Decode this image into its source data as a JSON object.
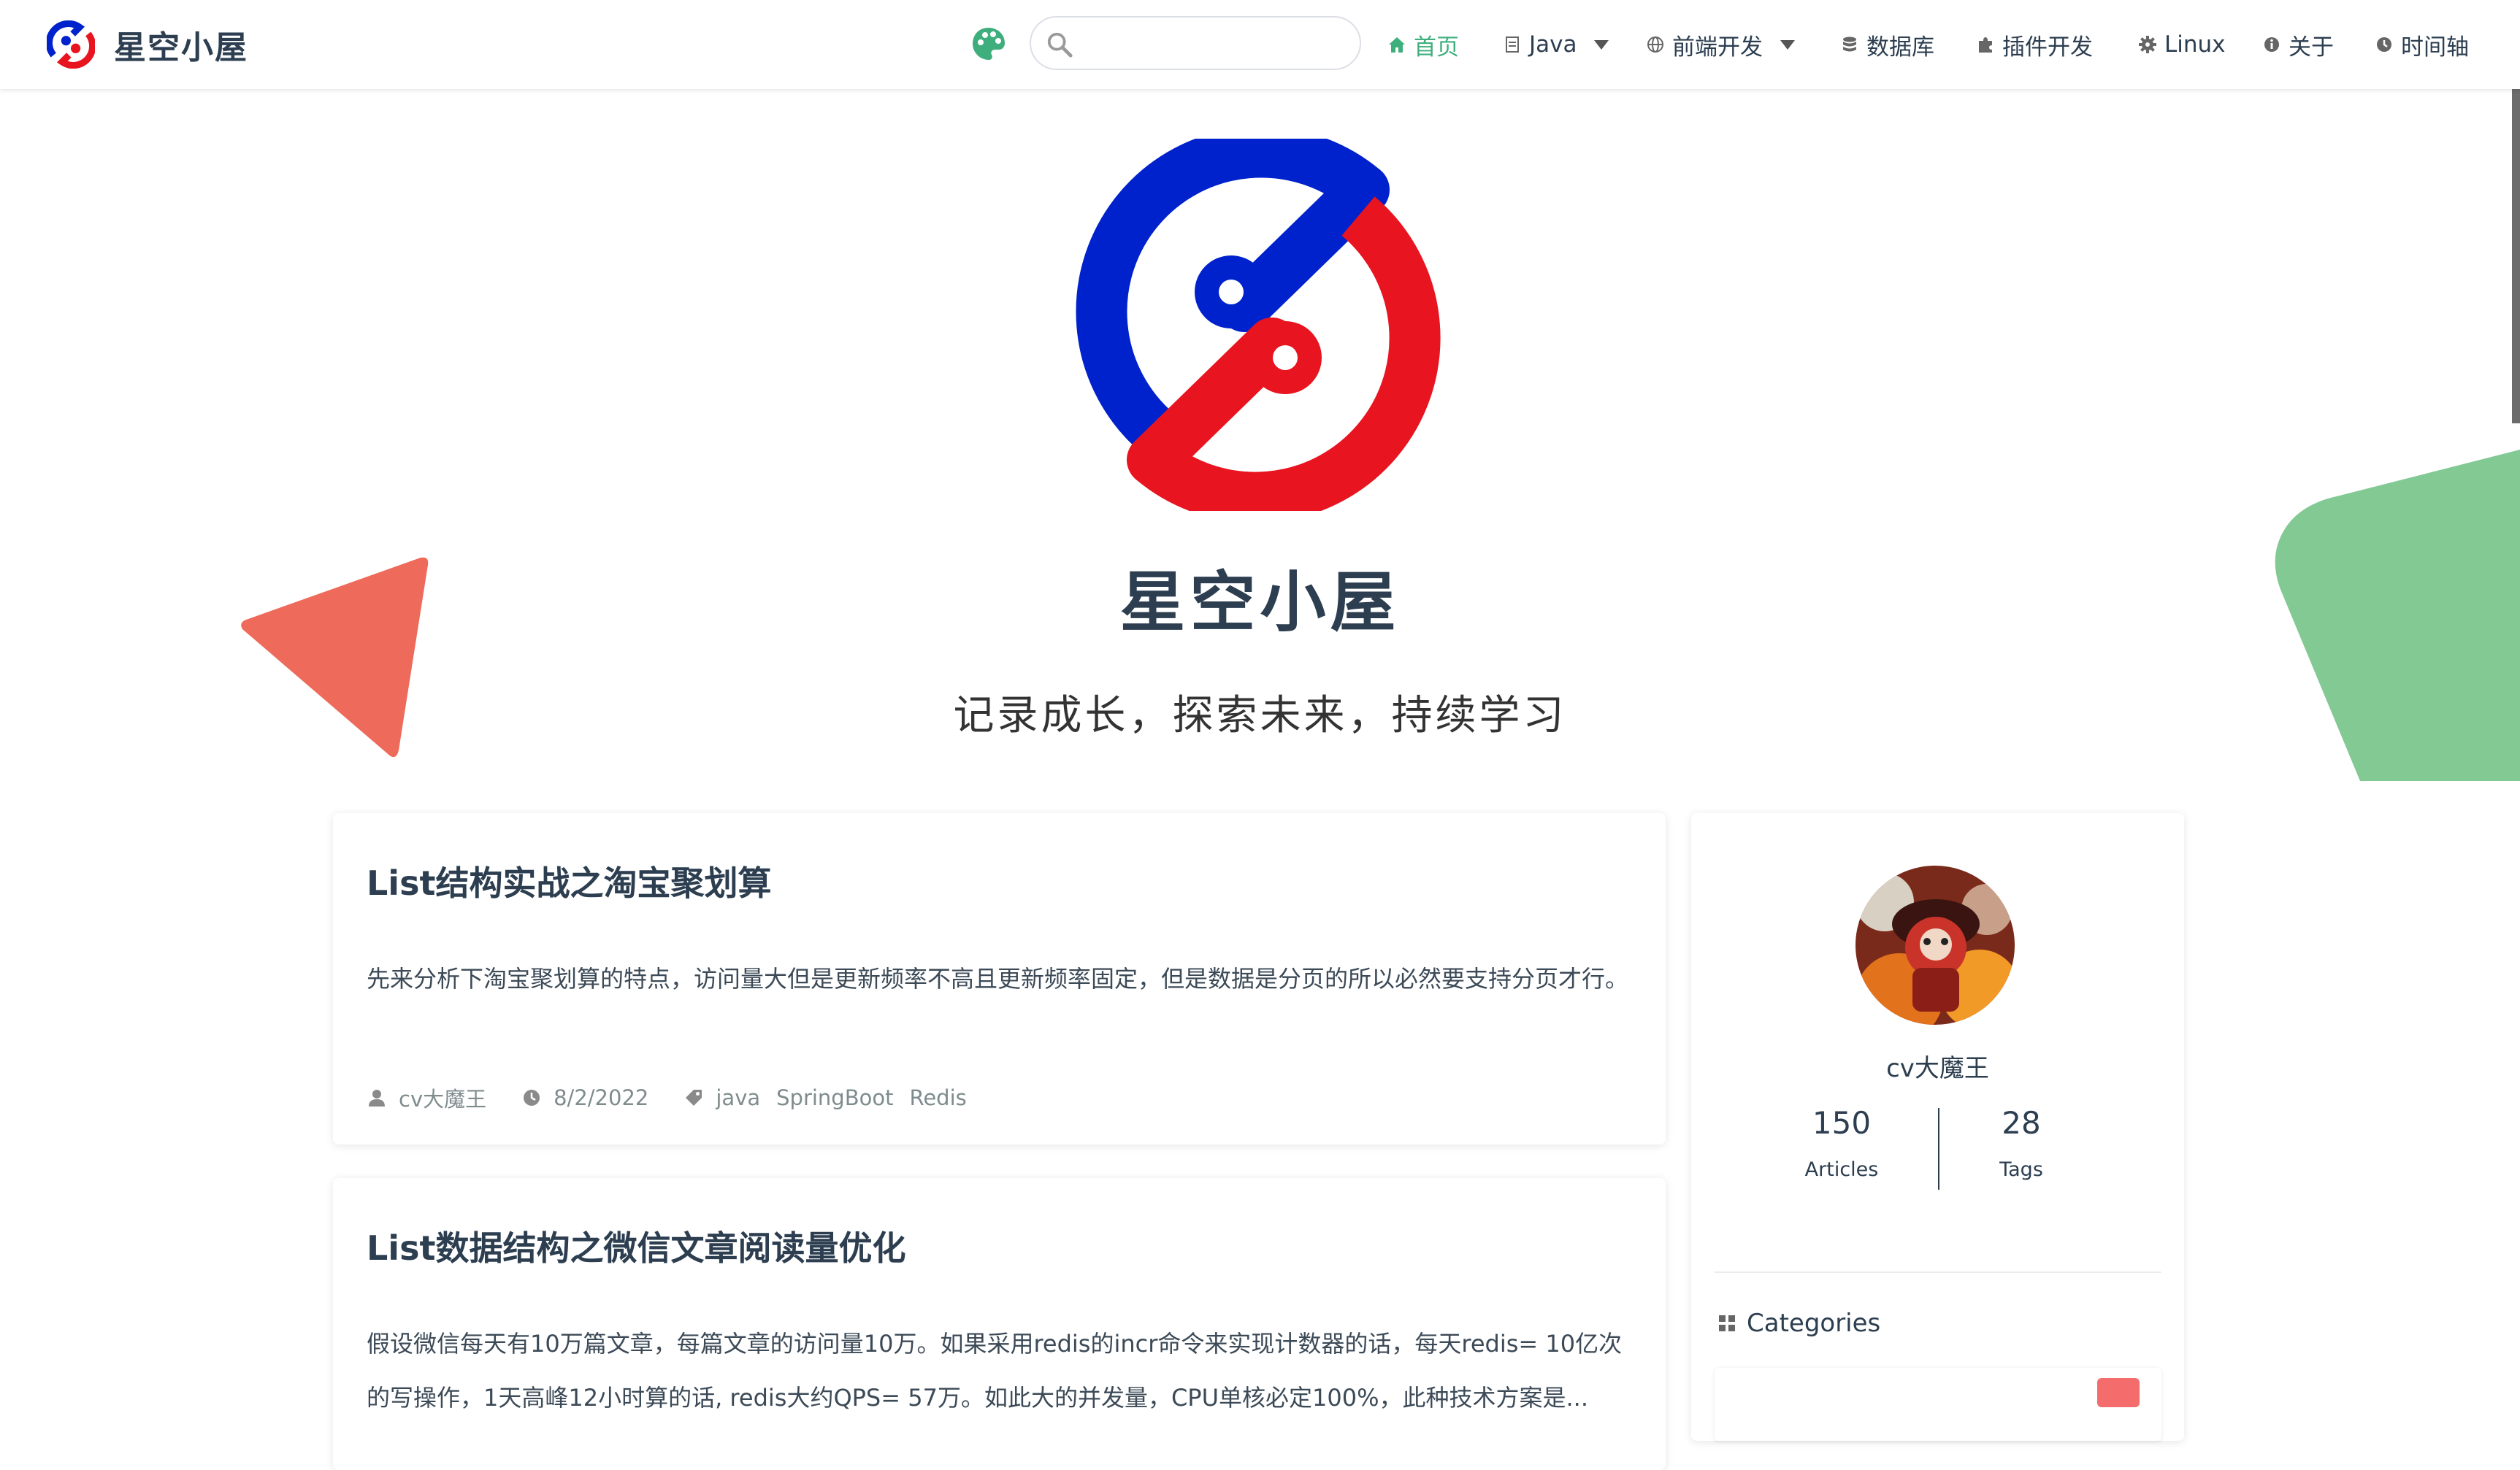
{
  "brand": {
    "title": "星空小屋",
    "logo_colors": {
      "blue": "#0022cc",
      "red": "#e8141f"
    }
  },
  "search": {
    "value": "",
    "placeholder": ""
  },
  "nav": [
    {
      "label": "首页",
      "icon": "home-icon",
      "active": true
    },
    {
      "label": "Java",
      "icon": "file-icon",
      "dropdown": true
    },
    {
      "label": "前端开发",
      "icon": "globe-icon",
      "dropdown": true
    },
    {
      "label": "数据库",
      "icon": "database-icon"
    },
    {
      "label": "插件开发",
      "icon": "puzzle-icon"
    },
    {
      "label": "Linux",
      "icon": "gear-icon"
    },
    {
      "label": "关于",
      "icon": "info-icon"
    },
    {
      "label": "时间轴",
      "icon": "clock-icon"
    }
  ],
  "hero": {
    "title": "星空小屋",
    "description": "记录成长，探索未来，持续学习"
  },
  "posts": [
    {
      "title": "List结构实战之淘宝聚划算",
      "excerpt": "先来分析下淘宝聚划算的特点，访问量大但是更新频率不高且更新频率固定，但是数据是分页的所以必然要支持分页才行。",
      "author": "cv大魔王",
      "date": "8/2/2022",
      "tags": [
        "java",
        "SpringBoot",
        "Redis"
      ]
    },
    {
      "title": "List数据结构之微信文章阅读量优化",
      "excerpt": "假设微信每天有10万篇文章，每篇文章的访问量10万。如果采用redis的incr命令来实现计数器的话，每天redis= 10亿次的写操作，1天高峰12小时算的话, redis大约QPS= 57万。如此大的并发量，CPU单核必定100%，此种技术方案是..."
    }
  ],
  "sidebar": {
    "author": "cv大魔王",
    "stats": [
      {
        "num": "150",
        "label": "Articles"
      },
      {
        "num": "28",
        "label": "Tags"
      }
    ],
    "categories_title": "Categories"
  },
  "colors": {
    "accent": "#3eaf7c",
    "deco_red": "#ee6a5a",
    "deco_green": "#82c994",
    "text": "#2c3e50"
  }
}
